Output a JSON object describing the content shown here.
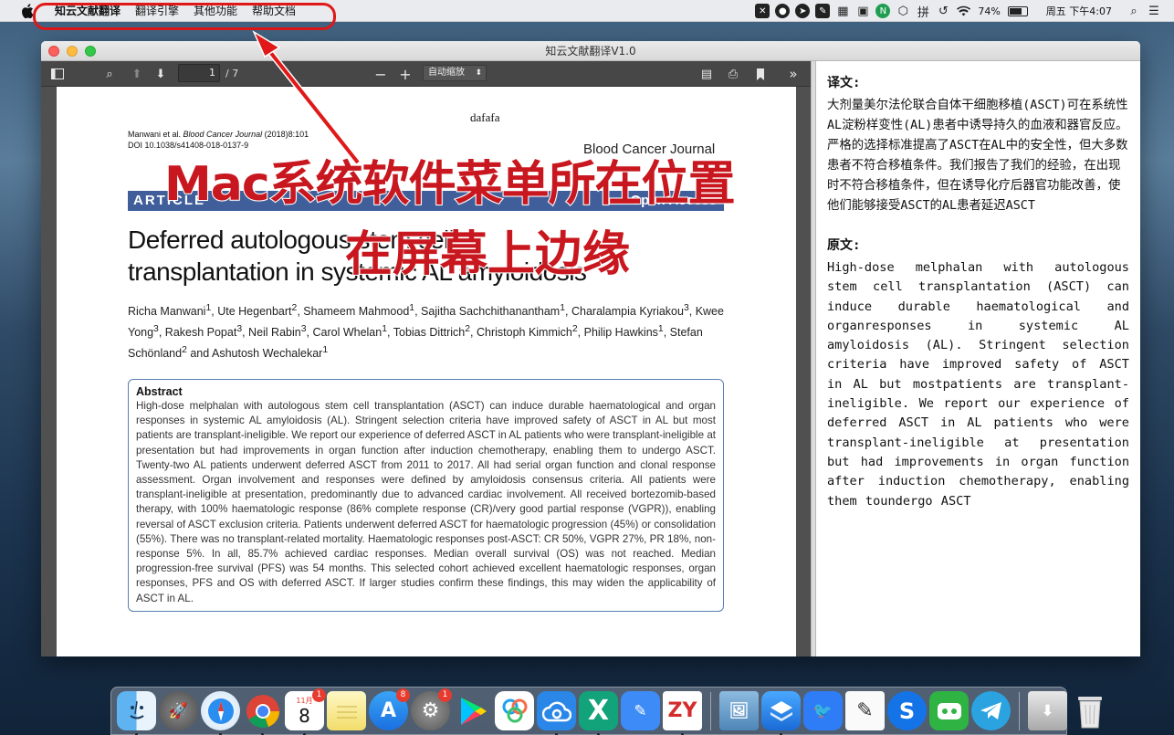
{
  "menubar": {
    "app_name": "知云文献翻译",
    "menus": [
      "翻译引擎",
      "其他功能",
      "帮助文档"
    ],
    "status_icons": [
      "x-app-icon",
      "chat-icon",
      "send-icon",
      "note-icon",
      "grid-icon",
      "screen-icon",
      "n-icon",
      "shield-icon",
      "pinyin-icon"
    ],
    "pinyin_glyph": "拼",
    "battery": "74%",
    "battery_level": 74,
    "clock": "周五 下午4:07"
  },
  "window": {
    "title": "知云文献翻译V1.0"
  },
  "pdf_toolbar": {
    "page_number": "1",
    "page_total": "/ 7",
    "zoom": "自动缩放"
  },
  "pdf_page": {
    "header_text": "dafafa",
    "cite_prefix": "Manwani et al. ",
    "cite_journal": "Blood Cancer Journal",
    "cite_suffix": " (2018)8:101",
    "doi": "DOI 10.1038/s41408-018-0137-9",
    "journal_name": "Blood Cancer Journal",
    "article_label": "ARTICLE",
    "open_access": "Open Access",
    "title_line1": "Deferred autologous stem cell",
    "title_line2": "transplantation in systemic AL amyloidosis",
    "authors_html": "Richa Manwani<sup>1</sup>, Ute Hegenbart<sup>2</sup>, Shameem Mahmood<sup>1</sup>, Sajitha Sachchithanantham<sup>1</sup>, Charalampia Kyriakou<sup>3</sup>, Kwee Yong<sup>3</sup>, Rakesh Popat<sup>3</sup>, Neil Rabin<sup>3</sup>, Carol Whelan<sup>1</sup>, Tobias Dittrich<sup>2</sup>, Christoph Kimmich<sup>2</sup>, Philip Hawkins<sup>1</sup>, Stefan Schönland<sup>2</sup> and Ashutosh Wechalekar<sup>1</sup>",
    "abstract_heading": "Abstract",
    "abstract_text": "High-dose melphalan with autologous stem cell transplantation (ASCT) can induce durable haematological and organ responses in systemic AL amyloidosis (AL). Stringent selection criteria have improved safety of ASCT in AL but most patients are transplant-ineligible. We report our experience of deferred ASCT in AL patients who were transplant-ineligible at presentation but had improvements in organ function after induction chemotherapy, enabling them to undergo ASCT. Twenty-two AL patients underwent deferred ASCT from 2011 to 2017. All had serial organ function and clonal response assessment. Organ involvement and responses were defined by amyloidosis consensus criteria. All patients were transplant-ineligible at presentation, predominantly due to advanced cardiac involvement. All received bortezomib-based therapy, with 100% haematologic response (86% complete response (CR)/very good partial response (VGPR)), enabling reversal of ASCT exclusion criteria. Patients underwent deferred ASCT for haematologic progression (45%) or consolidation (55%). There was no transplant-related mortality. Haematologic responses post-ASCT: CR 50%, VGPR 27%, PR 18%, non-response 5%. In all, 85.7% achieved cardiac responses. Median overall survival (OS) was not reached. Median progression-free survival (PFS) was 54 months. This selected cohort achieved excellent haematologic responses, organ responses, PFS and OS with deferred ASCT. If larger studies confirm these findings, this may widen the applicability of ASCT in AL."
  },
  "annotation": {
    "line1": "Mac系统软件菜单所在位置",
    "line2": "在屏幕上边缘"
  },
  "translation_panel": {
    "translation_label": "译文:",
    "translation_text": "大剂量美尔法伦联合自体干细胞移植(ASCT)可在系统性AL淀粉样变性(AL)患者中诱导持久的血液和器官反应。严格的选择标准提高了ASCT在AL中的安全性，但大多数患者不符合移植条件。我们报告了我们的经验，在出现时不符合移植条件，但在诱导化疗后器官功能改善，使他们能够接受ASCT的AL患者延迟ASCT",
    "original_label": "原文:",
    "original_text": "High-dose melphalan with autologous stem cell transplantation (ASCT) can induce durable haematological and organresponses in systemic AL amyloidosis (AL). Stringent selection criteria have improved safety of ASCT in AL but mostpatients are transplant-ineligible. We report our experience of deferred ASCT in AL patients who were transplant-ineligible at presentation but had improvements in organ function after induction chemotherapy, enabling them toundergo ASCT"
  },
  "dock": {
    "calendar_month": "11月",
    "calendar_day": "8",
    "calendar_badge": "1",
    "appstore_badge": "8",
    "settings_badge": "1",
    "zy_label": "ZY"
  }
}
